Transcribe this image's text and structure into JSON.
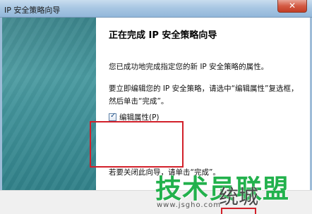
{
  "window": {
    "title": "IP 安全策略向导",
    "close_glyph": "✕"
  },
  "wizard": {
    "heading": "正在完成 IP 安全策略向导",
    "success_text": "您已成功地完成指定您的新 IP 安全策略的属性。",
    "edit_instructions": "要立即编辑您的 IP 安全策略，请选中“编辑属性”复选框，然后单击“完成”。",
    "edit_checkbox": {
      "label": "编辑属性(P)",
      "checked": true,
      "check_glyph": "✓"
    },
    "close_instructions": "若要关闭此向导，请单击“完成”。"
  },
  "watermark": {
    "main": "技术员联盟",
    "sub": "统城",
    "url": "www.jsgho.com"
  },
  "colors": {
    "annotation_red": "#d2202a",
    "side_panel": "#3d8d95",
    "watermark_green": "#22b14c"
  }
}
